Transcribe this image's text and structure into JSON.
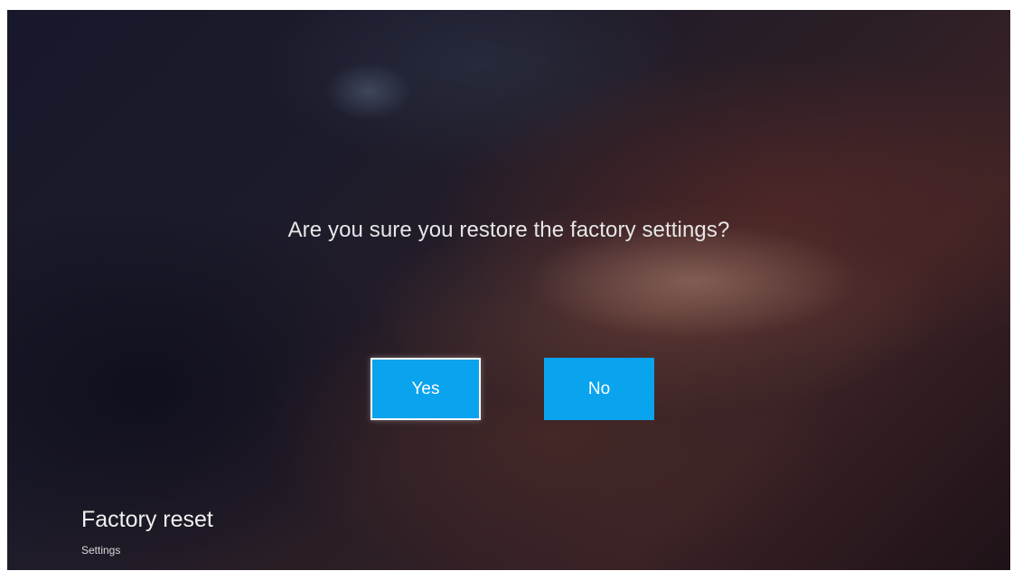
{
  "dialog": {
    "question": "Are you sure you restore the factory settings?",
    "yes_label": "Yes",
    "no_label": "No",
    "focused_button": "yes"
  },
  "footer": {
    "title": "Factory reset",
    "subtitle": "Settings"
  },
  "colors": {
    "button": "#0aa3ee",
    "focus_border": "#ffffff",
    "text": "#e6e6e6"
  }
}
